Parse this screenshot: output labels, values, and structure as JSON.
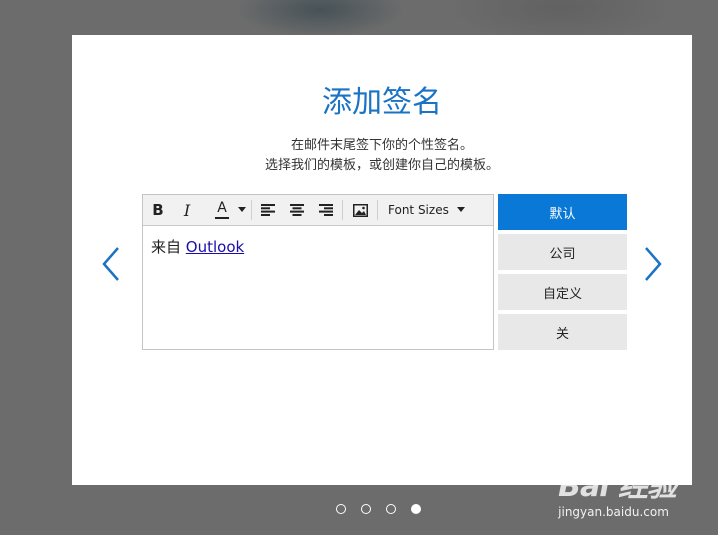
{
  "dialog": {
    "title": "添加签名",
    "subtitle_line1": "在邮件末尾签下你的个性签名。",
    "subtitle_line2": "选择我们的模板，或创建你自己的模板。"
  },
  "editor": {
    "toolbar": {
      "bold": "B",
      "italic": "I",
      "font_color": "A",
      "font_sizes": "Font Sizes"
    },
    "content": {
      "prefix": "来自 ",
      "link": "Outlook"
    }
  },
  "signature_options": [
    {
      "label": "默认",
      "active": true
    },
    {
      "label": "公司",
      "active": false
    },
    {
      "label": "自定义",
      "active": false
    },
    {
      "label": "关",
      "active": false
    }
  ],
  "pagination": {
    "total": 4,
    "current": 4
  },
  "watermark": {
    "top": "Bai 经验",
    "bottom": "jingyan.baidu.com"
  },
  "colors": {
    "accent": "#0a78d7",
    "title": "#1a73c4"
  }
}
